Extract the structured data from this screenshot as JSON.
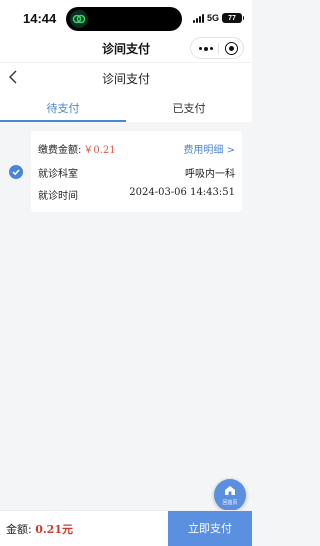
{
  "status_bar": {
    "time": "14:44",
    "network": "5G",
    "battery": "77"
  },
  "miniprogram": {
    "title": "诊间支付"
  },
  "page": {
    "title": "诊间支付"
  },
  "tabs": [
    {
      "label": "待支付",
      "active": true
    },
    {
      "label": "已支付",
      "active": false
    }
  ],
  "bill": {
    "amount_label": "缴费金额:",
    "amount_value": "￥0.21",
    "detail_link": "费用明细 >",
    "dept_label": "就诊科室",
    "dept_value": "呼吸内一科",
    "time_label": "就诊时间",
    "time_value": "2024-03-06 14:43:51"
  },
  "fab": {
    "label": "回首页"
  },
  "footer": {
    "total_label": "金额: ",
    "total_value": "0.21元",
    "pay_button": "立即支付"
  },
  "colors": {
    "accent": "#4a86d6",
    "price": "#e05a4e",
    "button": "#5b8fe0"
  }
}
